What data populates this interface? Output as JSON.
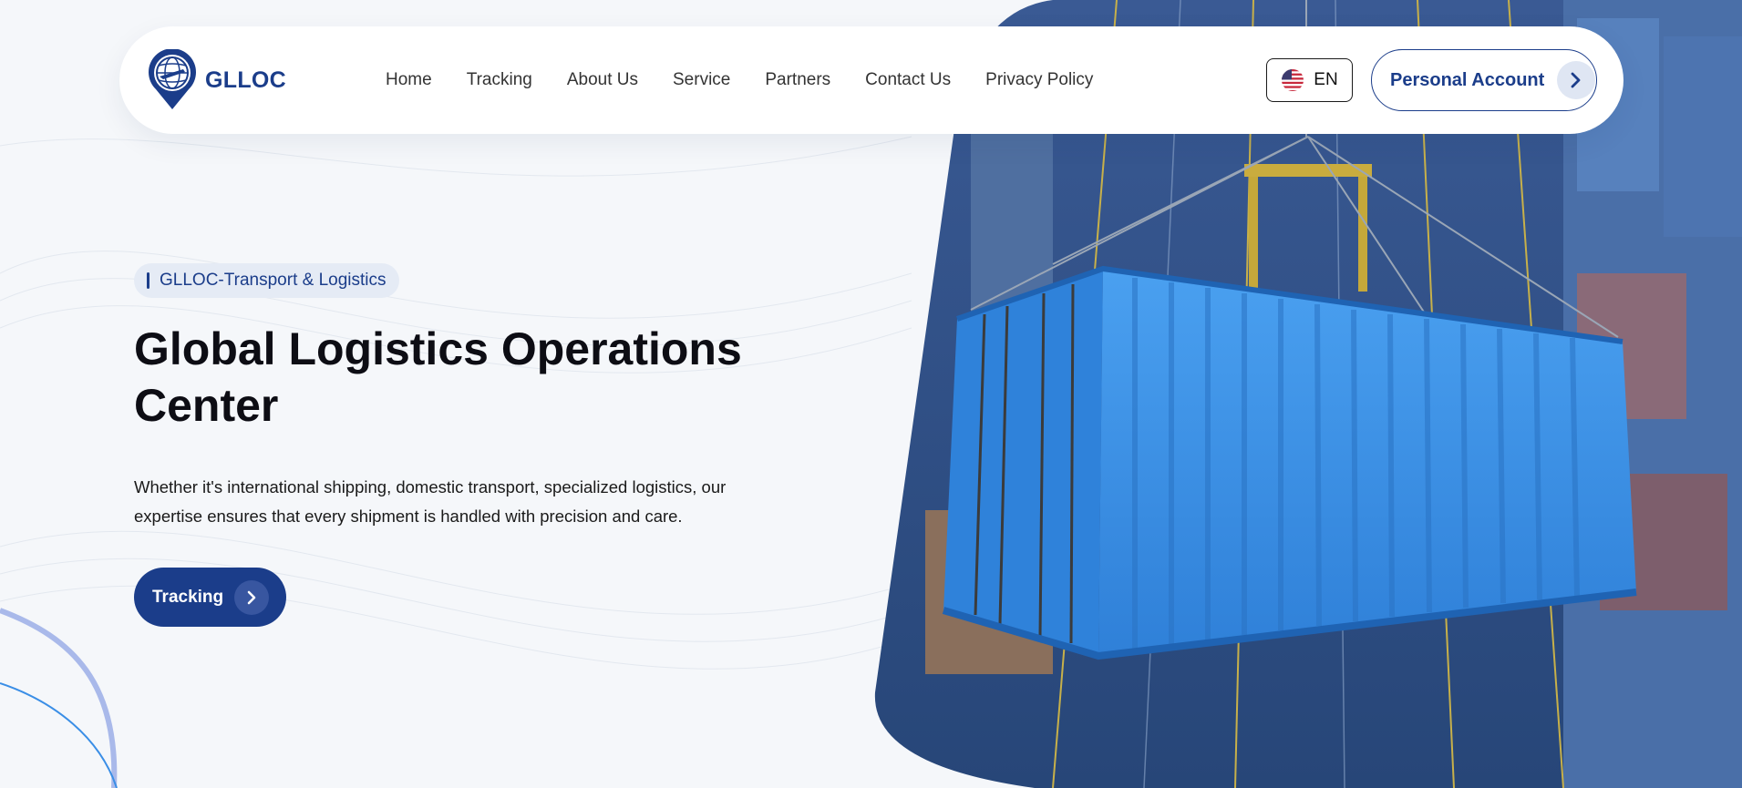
{
  "brand": {
    "name": "GLLOC",
    "logo_icon": "globe-pin-icon"
  },
  "nav": {
    "items": [
      {
        "label": "Home"
      },
      {
        "label": "Tracking"
      },
      {
        "label": "About Us"
      },
      {
        "label": "Service"
      },
      {
        "label": "Partners"
      },
      {
        "label": "Contact Us"
      },
      {
        "label": "Privacy Policy"
      }
    ]
  },
  "language": {
    "label": "EN",
    "flag_icon": "us-flag-icon"
  },
  "account": {
    "label": "Personal Account",
    "icon": "chevron-right-icon"
  },
  "hero": {
    "tag": "GLLOC-Transport & Logistics",
    "title": "Global Logistics Operations Center",
    "description": "Whether it's international shipping, domestic transport, specialized logistics, our expertise ensures that every shipment is handled with precision and care.",
    "cta_label": "Tracking",
    "image": "shipping-container-photo"
  },
  "colors": {
    "brand_navy": "#1b3d8a",
    "background": "#f5f7fa",
    "container_blue": "#3f93e6"
  }
}
